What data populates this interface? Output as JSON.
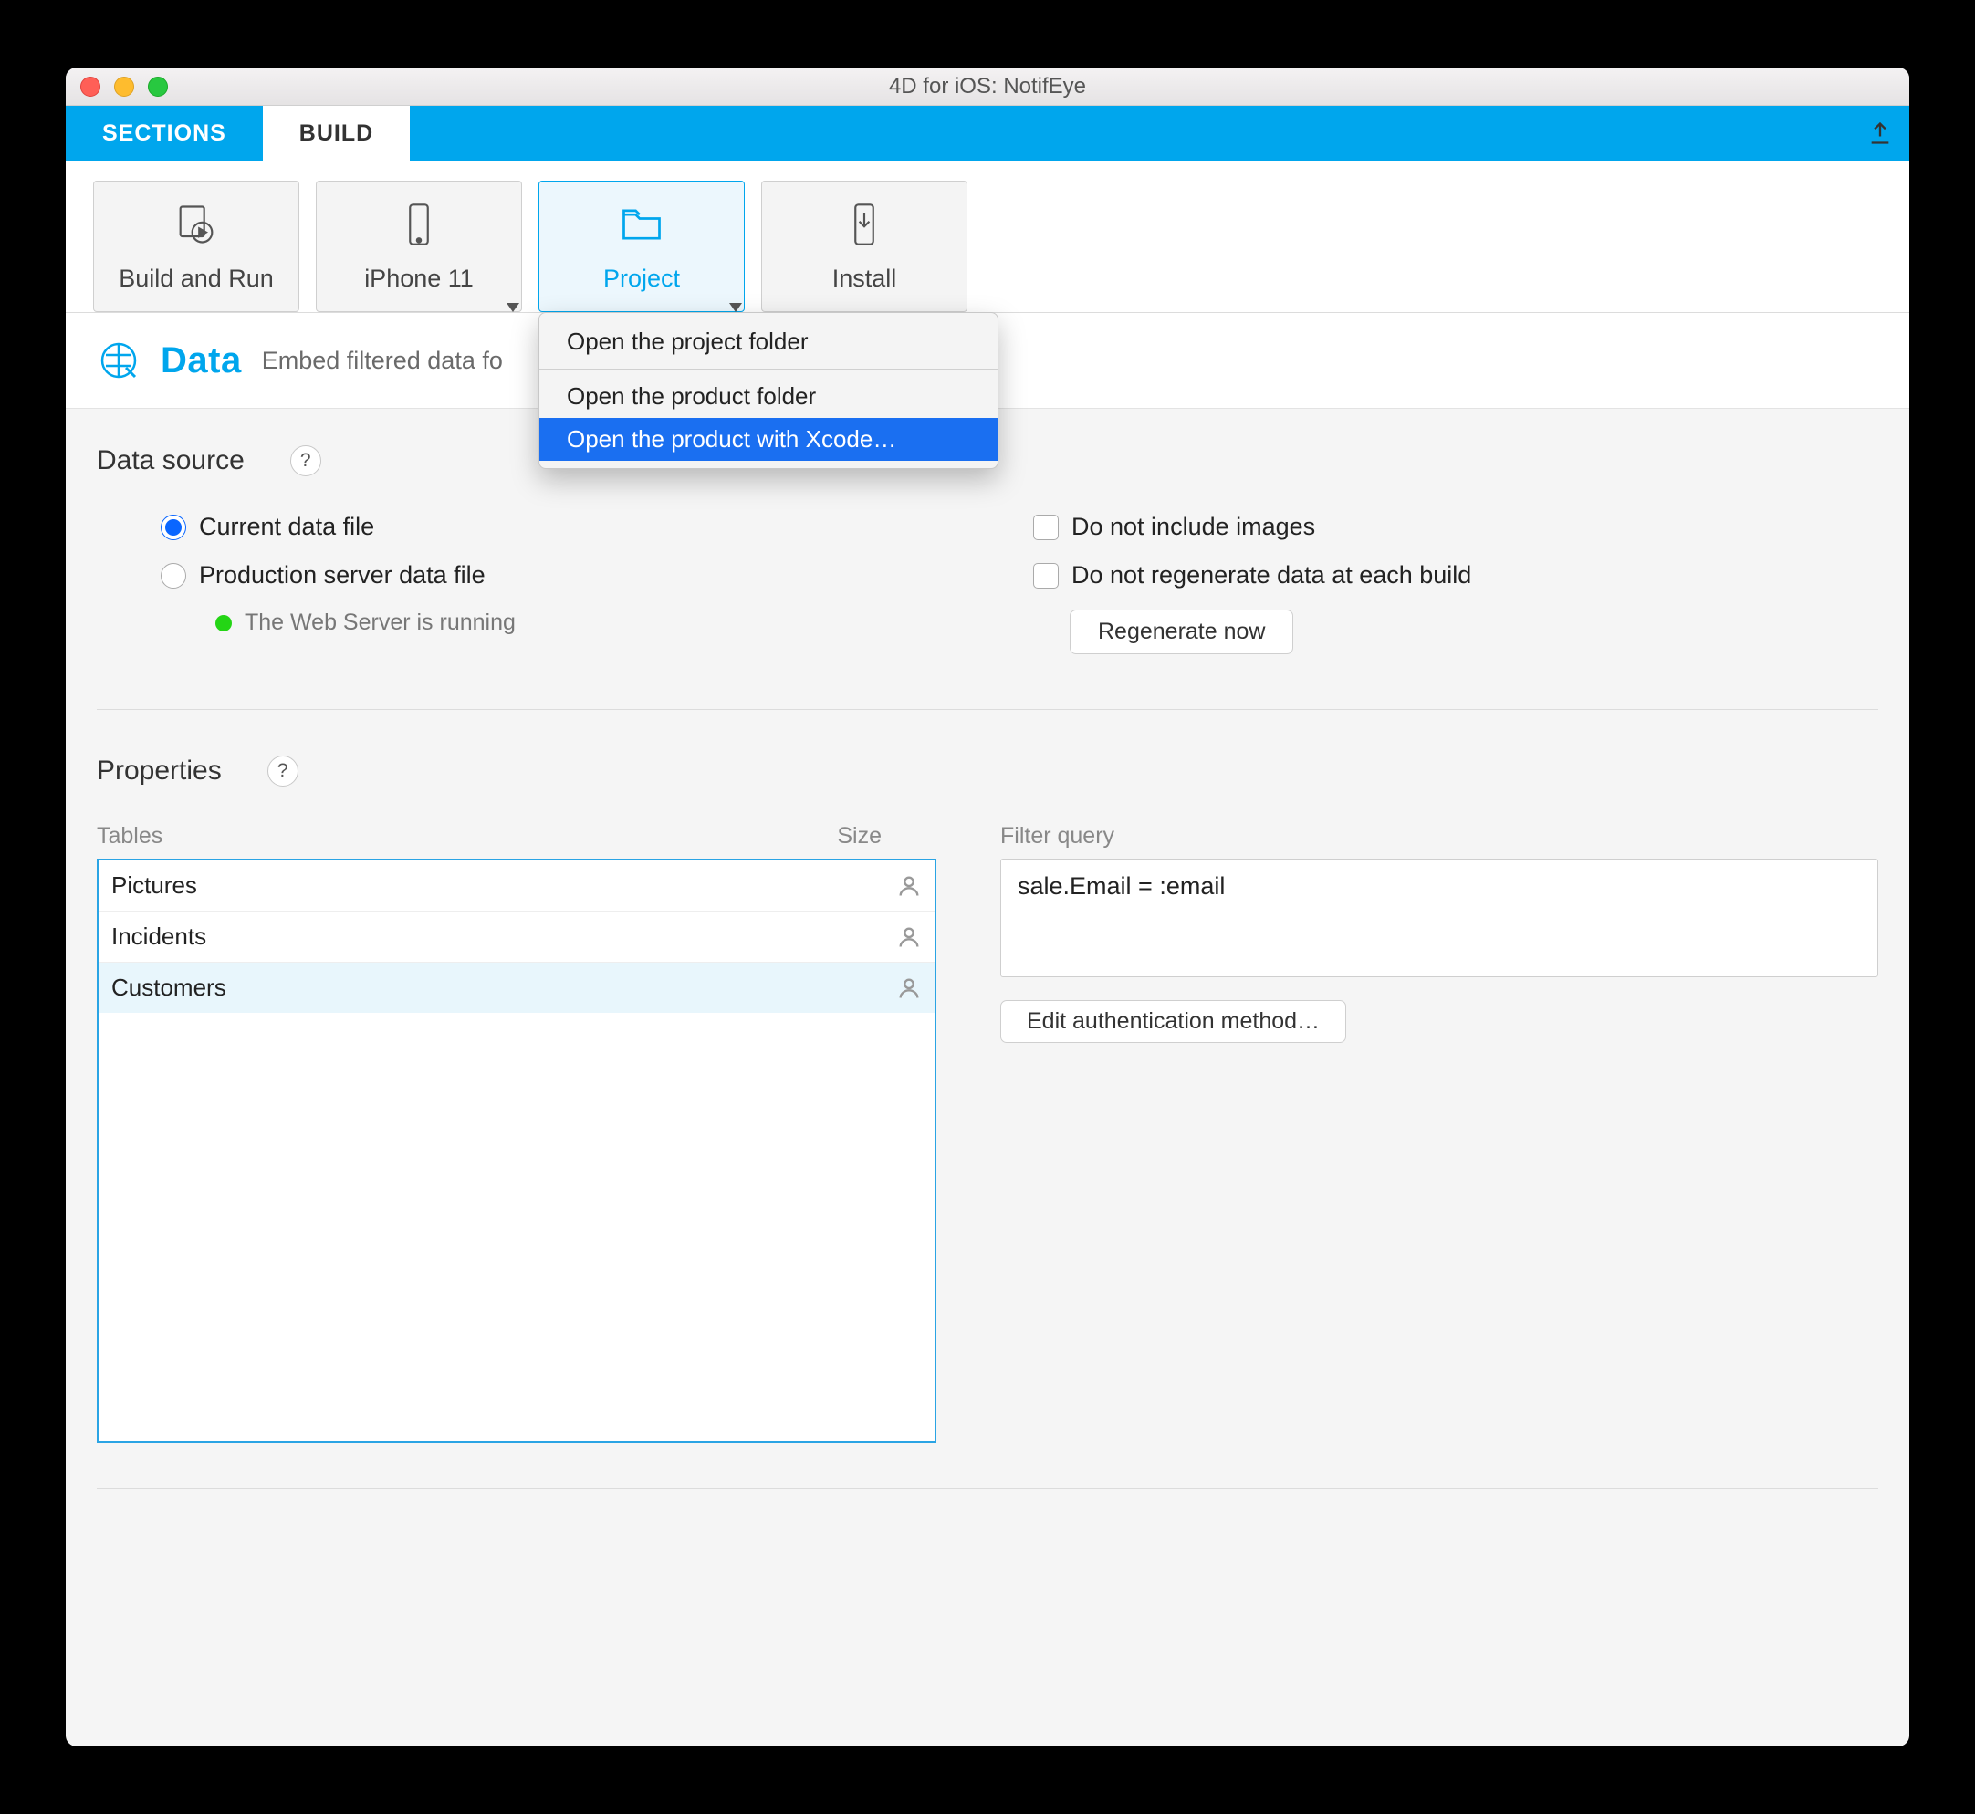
{
  "window_title": "4D for iOS: NotifEye",
  "tabs": {
    "sections": "SECTIONS",
    "build": "BUILD"
  },
  "toolbar": {
    "build_run": "Build and Run",
    "device": "iPhone 11",
    "project": "Project",
    "install": "Install"
  },
  "project_menu": {
    "open_project_folder": "Open the project folder",
    "open_product_folder": "Open the product folder",
    "open_with_xcode": "Open the product with Xcode…"
  },
  "data_section": {
    "title": "Data",
    "subtitle": "Embed filtered data fo"
  },
  "data_source": {
    "heading": "Data source",
    "option_current": "Current data file",
    "option_production": "Production server data file",
    "server_status": "The Web Server is running",
    "check_no_images": "Do not include images",
    "check_no_regenerate": "Do not regenerate data at each build",
    "regenerate_btn": "Regenerate now"
  },
  "properties": {
    "heading": "Properties",
    "col_tables": "Tables",
    "col_size": "Size",
    "col_filter": "Filter query",
    "tables": [
      {
        "name": "Pictures",
        "selected": false
      },
      {
        "name": "Incidents",
        "selected": false
      },
      {
        "name": "Customers",
        "selected": true
      }
    ],
    "filter_query": "sale.Email = :email",
    "edit_auth_btn": "Edit authentication method…"
  }
}
